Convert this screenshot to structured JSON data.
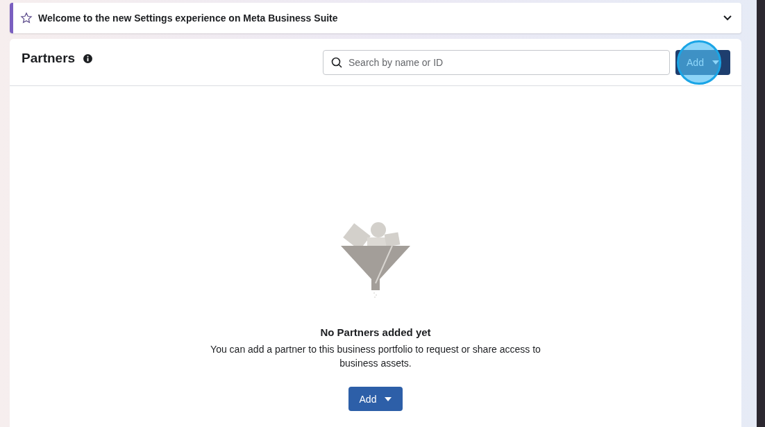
{
  "banner": {
    "title": "Welcome to the new Settings experience on Meta Business Suite",
    "expanded": false
  },
  "header": {
    "title": "Partners",
    "search": {
      "placeholder": "Search by name or ID"
    },
    "add_button": {
      "label": "Add",
      "highlighted": true
    }
  },
  "empty_state": {
    "title": "No Partners added yet",
    "message": "You can add a partner to this business portfolio to request or share access to business assets.",
    "add_button": {
      "label": "Add"
    }
  }
}
